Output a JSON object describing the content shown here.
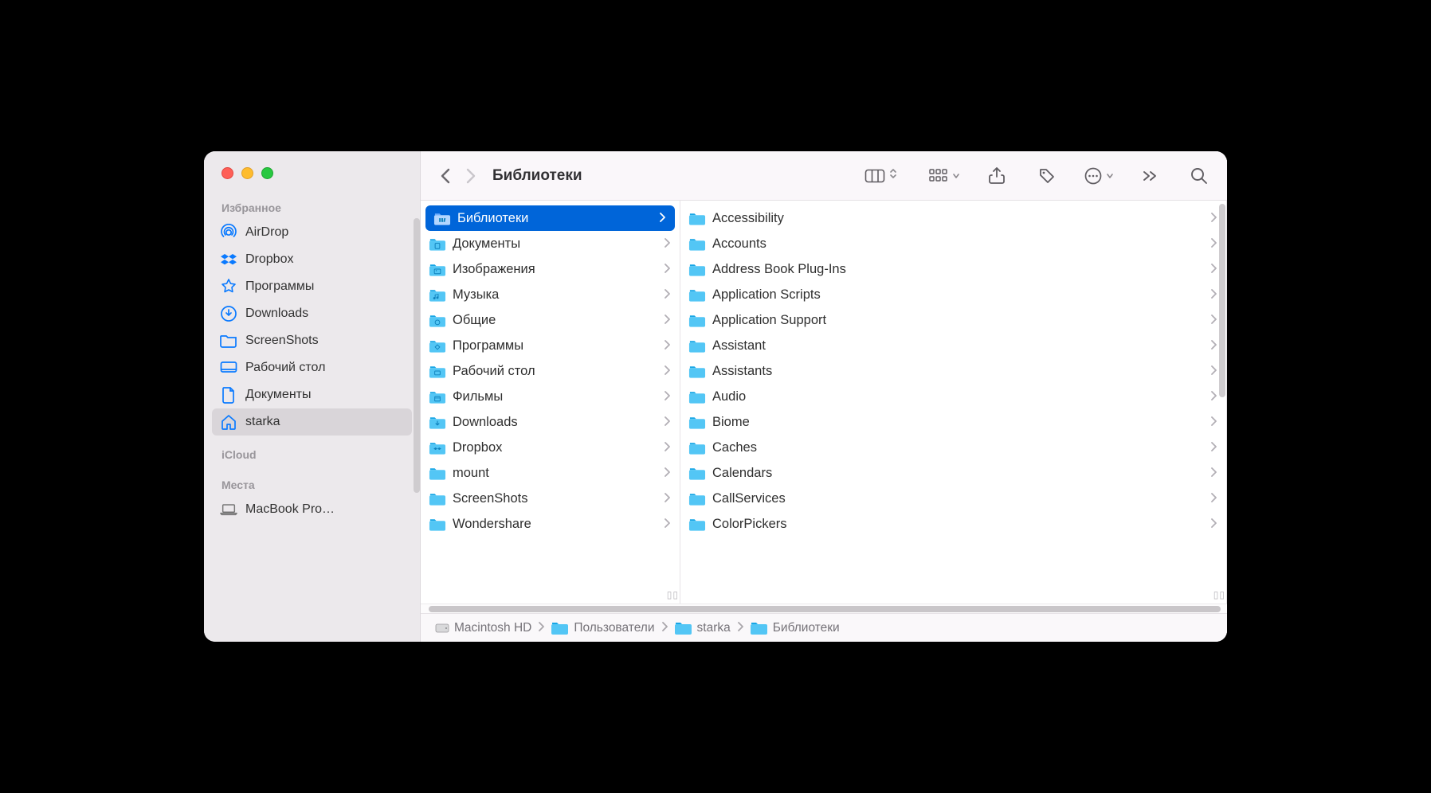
{
  "window_title": "Библиотеки",
  "sidebar": {
    "sections": [
      {
        "title": "Избранное",
        "items": [
          {
            "icon": "airdrop",
            "label": "AirDrop",
            "selected": false
          },
          {
            "icon": "dropbox",
            "label": "Dropbox",
            "selected": false
          },
          {
            "icon": "apps",
            "label": "Программы",
            "selected": false
          },
          {
            "icon": "downloads",
            "label": "Downloads",
            "selected": false
          },
          {
            "icon": "folder",
            "label": "ScreenShots",
            "selected": false
          },
          {
            "icon": "desktop",
            "label": "Рабочий стол",
            "selected": false
          },
          {
            "icon": "doc",
            "label": "Документы",
            "selected": false
          },
          {
            "icon": "home",
            "label": "starka",
            "selected": true
          }
        ]
      },
      {
        "title": "iCloud",
        "items": []
      },
      {
        "title": "Места",
        "items": [
          {
            "icon": "laptop",
            "label": "MacBook Pro…",
            "selected": false
          }
        ]
      }
    ]
  },
  "column1": [
    {
      "label": "Библиотеки",
      "selected": true,
      "glyph": "library"
    },
    {
      "label": "Документы",
      "selected": false,
      "glyph": "doc"
    },
    {
      "label": "Изображения",
      "selected": false,
      "glyph": "image"
    },
    {
      "label": "Музыка",
      "selected": false,
      "glyph": "music"
    },
    {
      "label": "Общие",
      "selected": false,
      "glyph": "public"
    },
    {
      "label": "Программы",
      "selected": false,
      "glyph": "apps"
    },
    {
      "label": "Рабочий стол",
      "selected": false,
      "glyph": "desktop"
    },
    {
      "label": "Фильмы",
      "selected": false,
      "glyph": "movie"
    },
    {
      "label": "Downloads",
      "selected": false,
      "glyph": "downloads"
    },
    {
      "label": "Dropbox",
      "selected": false,
      "glyph": "dropbox"
    },
    {
      "label": "mount",
      "selected": false,
      "glyph": ""
    },
    {
      "label": "ScreenShots",
      "selected": false,
      "glyph": ""
    },
    {
      "label": "Wondershare",
      "selected": false,
      "glyph": ""
    }
  ],
  "column2": [
    {
      "label": "Accessibility"
    },
    {
      "label": "Accounts"
    },
    {
      "label": "Address Book Plug-Ins"
    },
    {
      "label": "Application Scripts"
    },
    {
      "label": "Application Support"
    },
    {
      "label": "Assistant"
    },
    {
      "label": "Assistants"
    },
    {
      "label": "Audio"
    },
    {
      "label": "Biome"
    },
    {
      "label": "Caches"
    },
    {
      "label": "Calendars"
    },
    {
      "label": "CallServices"
    },
    {
      "label": "ColorPickers"
    }
  ],
  "pathbar": [
    {
      "icon": "hd",
      "label": "Macintosh HD"
    },
    {
      "icon": "folder",
      "label": "Пользователи"
    },
    {
      "icon": "folder",
      "label": "starka"
    },
    {
      "icon": "folder",
      "label": "Библиотеки"
    }
  ]
}
